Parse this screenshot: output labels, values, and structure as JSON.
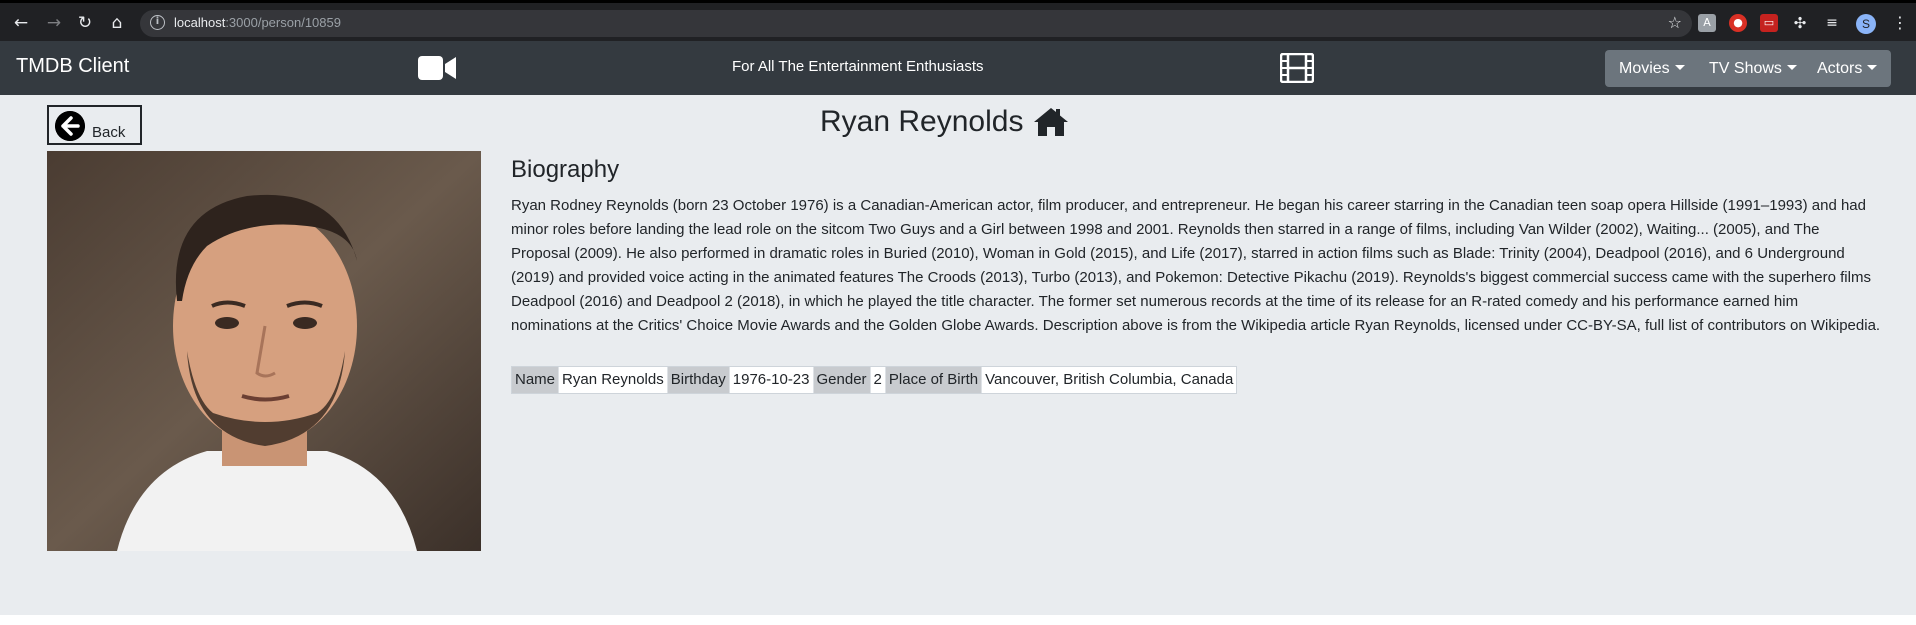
{
  "browser": {
    "url_host": "localhost",
    "url_path": ":3000/person/10859",
    "profile_initial": "S"
  },
  "navbar": {
    "brand": "TMDB Client",
    "tagline": "For All The Entertainment Enthusiasts",
    "menus": [
      "Movies",
      "TV Shows",
      "Actors"
    ]
  },
  "page": {
    "back_label": "Back",
    "title": "Ryan Reynolds",
    "bio_heading": "Biography",
    "bio_text": "Ryan Rodney Reynolds (born 23 October 1976) is a Canadian-American actor, film producer, and entrepreneur. He began his career starring in the Canadian teen soap opera Hillside (1991–1993) and had minor roles before landing the lead role on the sitcom Two Guys and a Girl between 1998 and 2001. Reynolds then starred in a range of films, including Van Wilder (2002), Waiting... (2005), and The Proposal (2009). He also performed in dramatic roles in Buried (2010), Woman in Gold (2015), and Life (2017), starred in action films such as Blade: Trinity (2004), Deadpool (2016), and 6 Underground (2019) and provided voice acting in the animated features The Croods (2013), Turbo (2013), and Pokemon: Detective Pikachu (2019). Reynolds's biggest commercial success came with the superhero films Deadpool (2016) and Deadpool 2 (2018), in which he played the title character. The former set numerous records at the time of its release for an R-rated comedy and his performance earned him nominations at the Critics' Choice Movie Awards and the Golden Globe Awards. Description above is from the Wikipedia article Ryan Reynolds, licensed under CC-BY-SA, full list of contributors on Wikipedia.",
    "details": {
      "name_label": "Name",
      "name_value": "Ryan Reynolds",
      "birthday_label": "Birthday",
      "birthday_value": "1976-10-23",
      "gender_label": "Gender",
      "gender_value": "2",
      "pob_label": "Place of Birth",
      "pob_value": "Vancouver, British Columbia, Canada"
    }
  }
}
